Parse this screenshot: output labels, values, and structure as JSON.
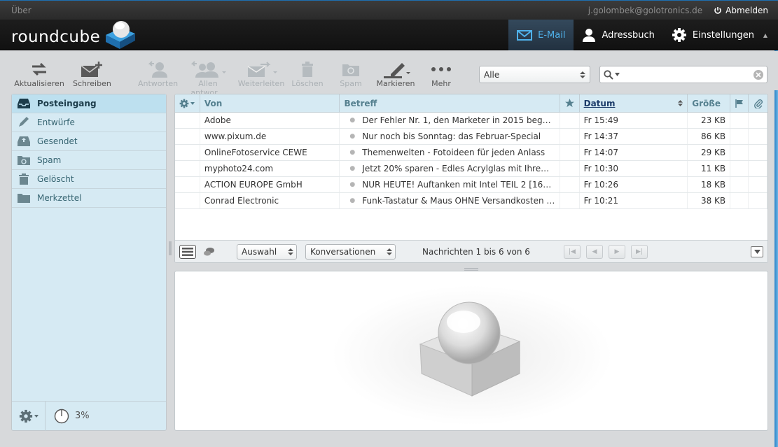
{
  "topbar": {
    "about": "Über",
    "user": "j.golombek@golotronics.de",
    "logout": "Abmelden"
  },
  "logo": {
    "text": "roundcube"
  },
  "nav": [
    {
      "label": "E-Mail",
      "active": true
    },
    {
      "label": "Adressbuch",
      "active": false
    },
    {
      "label": "Einstellungen",
      "active": false
    }
  ],
  "toolbar": {
    "refresh": "Aktualisieren",
    "compose": "Schreiben",
    "reply": "Antworten",
    "reply_all": "Allen antwor…",
    "forward": "Weiterleiten",
    "delete": "Löschen",
    "spam": "Spam",
    "mark": "Markieren",
    "more": "Mehr"
  },
  "filter": {
    "selected": "Alle"
  },
  "search": {
    "placeholder": ""
  },
  "folders": [
    {
      "label": "Posteingang",
      "icon": "inbox-icon",
      "active": true
    },
    {
      "label": "Entwürfe",
      "icon": "pencil-icon",
      "active": false
    },
    {
      "label": "Gesendet",
      "icon": "sent-icon",
      "active": false
    },
    {
      "label": "Spam",
      "icon": "spam-icon",
      "active": false
    },
    {
      "label": "Gelöscht",
      "icon": "trash-icon",
      "active": false
    },
    {
      "label": "Merkzettel",
      "icon": "folder-icon",
      "active": false
    }
  ],
  "quota": {
    "label": "3%"
  },
  "list": {
    "headers": {
      "from": "Von",
      "subject": "Betreff",
      "date": "Datum",
      "size": "Größe"
    },
    "rows": [
      {
        "from": "Adobe",
        "subject": "Der Fehler Nr. 1, den Marketer in 2015 begeh…",
        "date": "Fr 15:49",
        "size": "23 KB"
      },
      {
        "from": "www.pixum.de",
        "subject": "Nur noch bis Sonntag: das Februar-Special",
        "date": "Fr 14:37",
        "size": "86 KB"
      },
      {
        "from": "OnlineFotoservice CEWE",
        "subject": "Themenwelten - Fotoideen für jeden Anlass",
        "date": "Fr 14:07",
        "size": "29 KB"
      },
      {
        "from": "myphoto24.com",
        "subject": "Jetzt 20% sparen - Edles Acrylglas mit Ihrem …",
        "date": "Fr 10:30",
        "size": "11 KB"
      },
      {
        "from": "ACTION EUROPE GmbH",
        "subject": "NUR HEUTE! Auftanken mit Intel TEIL 2 [1616…",
        "date": "Fr 10:26",
        "size": "18 KB"
      },
      {
        "from": "Conrad Electronic",
        "subject": "Funk-Tastatur & Maus OHNE Versandkosten fü…",
        "date": "Fr 10:21",
        "size": "38 KB"
      }
    ],
    "footer": {
      "selection": "Auswahl",
      "threads": "Konversationen",
      "count": "Nachrichten 1 bis 6 von 6"
    }
  },
  "colors": {
    "accent": "#4fb1ea",
    "sidebar_bg": "#d6eaf3",
    "header_bg": "#1d1d1d"
  }
}
